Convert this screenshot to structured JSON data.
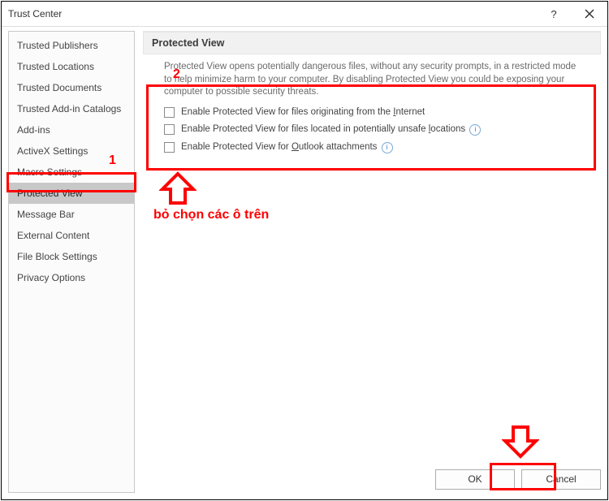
{
  "titlebar": {
    "title": "Trust Center"
  },
  "sidebar": {
    "items": [
      {
        "label": "Trusted Publishers",
        "selected": false
      },
      {
        "label": "Trusted Locations",
        "selected": false
      },
      {
        "label": "Trusted Documents",
        "selected": false
      },
      {
        "label": "Trusted Add-in Catalogs",
        "selected": false
      },
      {
        "label": "Add-ins",
        "selected": false
      },
      {
        "label": "ActiveX Settings",
        "selected": false
      },
      {
        "label": "Macro Settings",
        "selected": false
      },
      {
        "label": "Protected View",
        "selected": true
      },
      {
        "label": "Message Bar",
        "selected": false
      },
      {
        "label": "External Content",
        "selected": false
      },
      {
        "label": "File Block Settings",
        "selected": false
      },
      {
        "label": "Privacy Options",
        "selected": false
      }
    ]
  },
  "content": {
    "header": "Protected View",
    "description": "Protected View opens potentially dangerous files, without any security prompts, in a restricted mode to help minimize harm to your computer. By disabling Protected View you could be exposing your computer to possible security threats.",
    "checks": [
      {
        "pre": "Enable Protected View for files originating from the ",
        "u": "I",
        "post": "nternet",
        "info": false
      },
      {
        "pre": "Enable Protected View for files located in potentially unsafe ",
        "u": "l",
        "post": "ocations",
        "info": true
      },
      {
        "pre": "Enable Protected View for ",
        "u": "O",
        "post": "utlook attachments",
        "info": true
      }
    ]
  },
  "footer": {
    "ok": "OK",
    "cancel": "Cancel"
  },
  "annotations": {
    "num1": "1",
    "num2": "2",
    "caption": "bỏ chọn các ô trên",
    "colors": {
      "red": "#ff0000"
    }
  }
}
